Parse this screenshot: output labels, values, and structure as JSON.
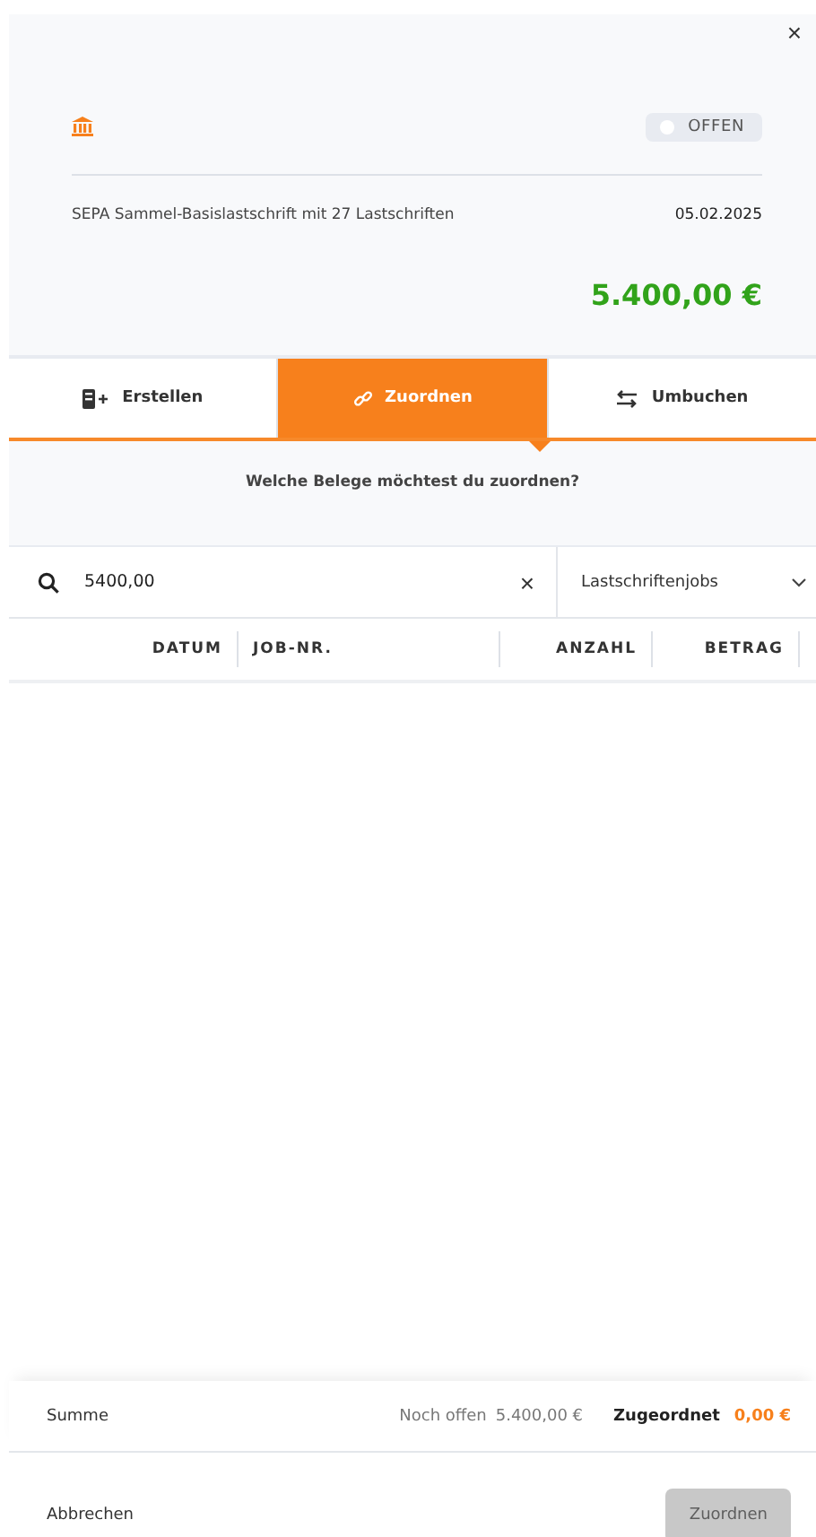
{
  "close": "×",
  "header": {
    "status": {
      "label": "OFFEN"
    },
    "description": "SEPA Sammel-Basislastschrift mit 27 Lastschriften",
    "date": "05.02.2025",
    "amount": "5.400,00 €"
  },
  "tabs": [
    {
      "label": "Erstellen",
      "kind": "create",
      "selected": false
    },
    {
      "label": "Zuordnen",
      "kind": "assign",
      "selected": true
    },
    {
      "label": "Umbuchen",
      "kind": "transfer",
      "selected": false
    }
  ],
  "prompt": "Welche Belege möchtest du zuordnen?",
  "search": {
    "value": "5400,00",
    "clear": "×"
  },
  "filter": {
    "value": "Lastschriftenjobs"
  },
  "table": {
    "columns": [
      "DATUM",
      "JOB-NR.",
      "ANZAHL",
      "BETRAG"
    ]
  },
  "summary": {
    "label": "Summe",
    "open_label": "Noch offen",
    "open_value": "5.400,00 €",
    "assigned_label": "Zugeordnet",
    "assigned_value": "0,00 €"
  },
  "footer": {
    "cancel": "Abbrechen",
    "submit": {
      "label": "Zuordnen",
      "disabled": true
    }
  }
}
